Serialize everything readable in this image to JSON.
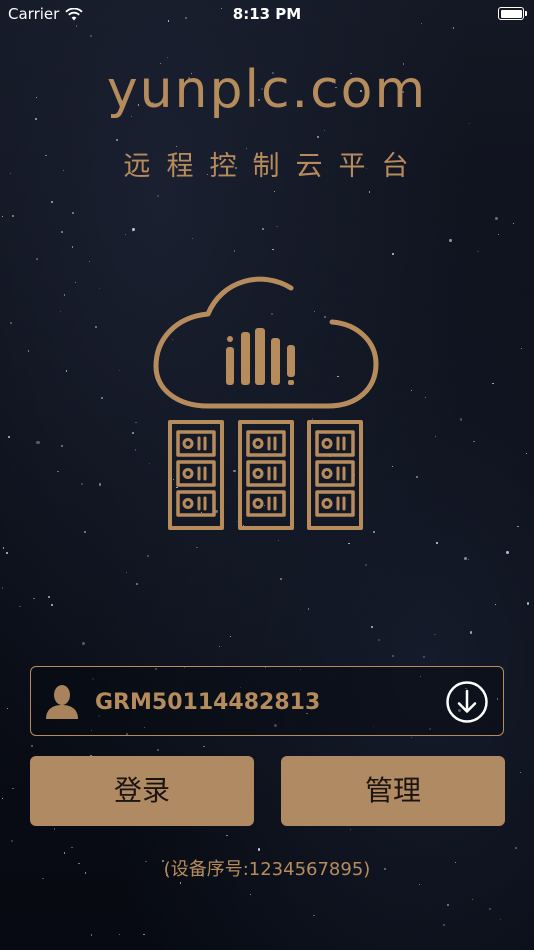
{
  "status_bar": {
    "carrier": "Carrier",
    "time": "8:13 PM"
  },
  "header": {
    "brand": "yunplc.com",
    "subtitle": "远程控制云平台"
  },
  "logo": {
    "icon": "cloud-server-icon",
    "color": "#b78c5d"
  },
  "login_form": {
    "device_id_value": "GRM50114482813",
    "login_label": "登录",
    "manage_label": "管理",
    "serial_text": "(设备序号:1234567895)"
  },
  "colors": {
    "accent": "#b78c5d",
    "button_bg": "#b08a63",
    "background": "#0b0f1a"
  }
}
